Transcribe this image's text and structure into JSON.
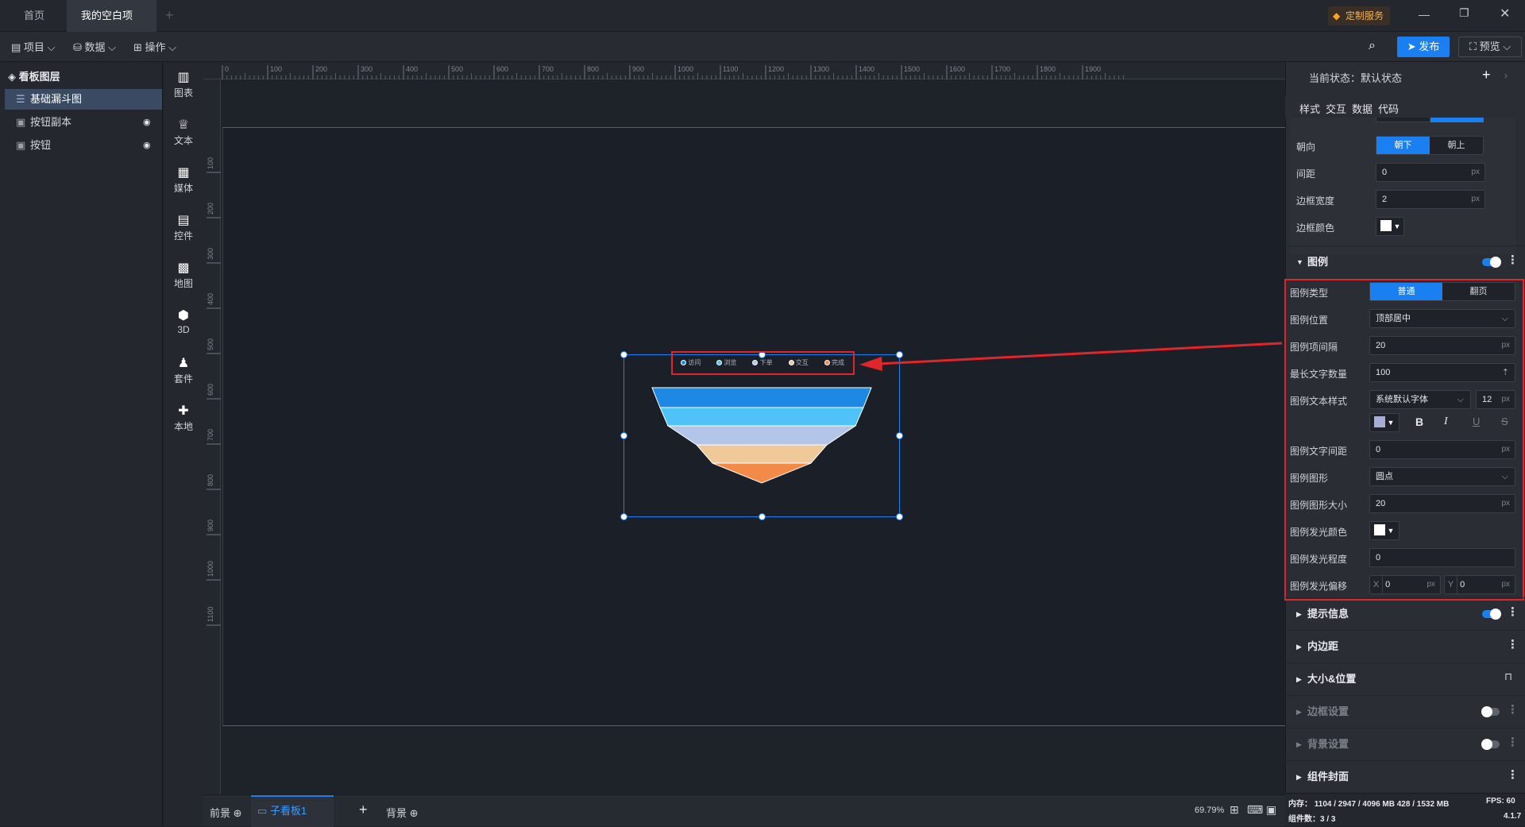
{
  "titlebar": {
    "tabs": [
      {
        "label": "首页"
      },
      {
        "label": "我的空白项目"
      }
    ],
    "custom_service": "定制服务"
  },
  "toolbar": {
    "menus": [
      {
        "label": "项目"
      },
      {
        "label": "数据"
      },
      {
        "label": "操作"
      }
    ],
    "publish": "发布",
    "preview": "预览"
  },
  "layers": {
    "title": "看板图层",
    "items": [
      {
        "label": "基础漏斗图"
      },
      {
        "label": "按钮副本"
      },
      {
        "label": "按钮"
      }
    ]
  },
  "components": [
    {
      "label": "图表",
      "icon": "chart-icon"
    },
    {
      "label": "文本",
      "icon": "text-icon"
    },
    {
      "label": "媒体",
      "icon": "media-icon"
    },
    {
      "label": "控件",
      "icon": "control-icon"
    },
    {
      "label": "地图",
      "icon": "map-icon"
    },
    {
      "label": "3D",
      "icon": "cube-icon"
    },
    {
      "label": "套件",
      "icon": "kit-icon"
    },
    {
      "label": "本地",
      "icon": "puzzle-icon"
    }
  ],
  "rulers": {
    "top": [
      "0",
      "100",
      "200",
      "300",
      "400",
      "500",
      "600",
      "700",
      "800",
      "900",
      "1000",
      "1100",
      "1200",
      "1300",
      "1400",
      "1500",
      "1600",
      "1700",
      "1800",
      "1900"
    ],
    "left": [
      "100",
      "200",
      "300",
      "400",
      "500",
      "600",
      "700",
      "800",
      "900",
      "1000",
      "1100"
    ]
  },
  "funnel": {
    "legend": [
      "访问",
      "浏览",
      "下单",
      "交互",
      "完成"
    ],
    "colors": [
      "#1e88e5",
      "#4fc3f7",
      "#b3c6ea",
      "#f0c99b",
      "#f28b48"
    ]
  },
  "right_panel": {
    "state_label": "当前状态：默认状态",
    "tabs": [
      "样式",
      "交互",
      "数据",
      "代码"
    ],
    "top_rows": {
      "direction_label": "朝向",
      "direction_options": [
        "朝下",
        "朝上"
      ],
      "gap_label": "间距",
      "gap_value": "0",
      "border_width_label": "边框宽度",
      "border_width_value": "2",
      "border_color_label": "边框颜色",
      "unit": "px"
    },
    "legend_section": {
      "title": "图例",
      "type_label": "图例类型",
      "type_options": [
        "普通",
        "翻页"
      ],
      "position_label": "图例位置",
      "position_value": "顶部居中",
      "item_gap_label": "图例项间隔",
      "item_gap_value": "20",
      "max_text_label": "最长文字数量",
      "max_text_value": "100",
      "text_style_label": "图例文本样式",
      "font_value": "系统默认字体",
      "font_size_value": "12",
      "bold": "B",
      "italic": "I",
      "underline": "U",
      "strike": "S",
      "text_spacing_label": "图例文字间距",
      "text_spacing_value": "0",
      "shape_label": "图例图形",
      "shape_value": "圆点",
      "shape_size_label": "图例图形大小",
      "shape_size_value": "20",
      "glow_color_label": "图例发光颜色",
      "glow_level_label": "图例发光程度",
      "glow_level_value": "0",
      "glow_offset_label": "图例发光偏移",
      "x_label": "X",
      "x_value": "0",
      "y_label": "Y",
      "y_value": "0",
      "unit": "px"
    },
    "sections": [
      {
        "label": "提示信息"
      },
      {
        "label": "内边距"
      },
      {
        "label": "大小&位置"
      },
      {
        "label": "边框设置"
      },
      {
        "label": "背景设置"
      },
      {
        "label": "组件封面"
      }
    ]
  },
  "bottombar": {
    "foreground": "前景",
    "sub_board": "子看板1",
    "background": "背景",
    "zoom": "69.79%"
  },
  "status": {
    "memory": "内存： 1104 / 2947 / 4096 MB  428 / 1532 MB",
    "fps": "FPS:  60",
    "components": "组件数：3 / 3",
    "version": "4.1.7"
  },
  "accent_color": "#1a7ff0"
}
